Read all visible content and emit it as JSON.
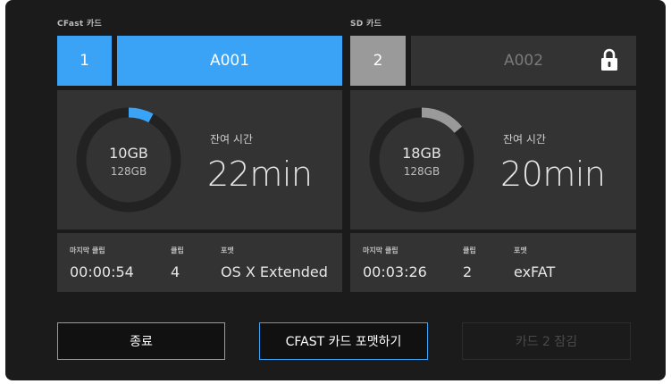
{
  "cfast": {
    "title": "CFast 카드",
    "slot": "1",
    "clip": "A001",
    "used": "10GB",
    "total": "128GB",
    "remaining_label": "잔여 시간",
    "remaining_time": "22min",
    "last_clip_label": "마지막 클립",
    "last_clip": "00:00:54",
    "clips_label": "클립",
    "clips": "4",
    "format_label": "포맷",
    "format": "OS X Extended",
    "usage_fraction": 0.078,
    "accent": "#3aa3f5"
  },
  "sd": {
    "title": "SD 카드",
    "slot": "2",
    "clip": "A002",
    "locked": true,
    "lock_icon": "lock-icon",
    "used": "18GB",
    "total": "128GB",
    "remaining_label": "잔여 시간",
    "remaining_time": "20min",
    "last_clip_label": "마지막 클립",
    "last_clip": "00:03:26",
    "clips_label": "클립",
    "clips": "2",
    "format_label": "포맷",
    "format": "exFAT",
    "usage_fraction": 0.14,
    "accent": "#9a9a9a"
  },
  "buttons": {
    "exit": "종료",
    "format_cfast": "CFAST 카드 포맷하기",
    "lock_card2": "카드 2 잠김"
  }
}
